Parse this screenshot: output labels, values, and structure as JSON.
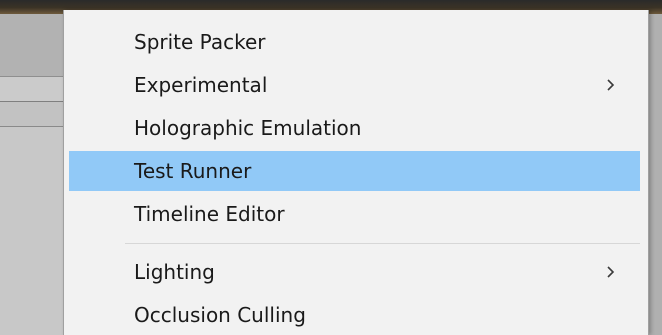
{
  "menu": {
    "items": [
      {
        "label": "Sprite Packer",
        "has_submenu": false,
        "highlighted": false
      },
      {
        "label": "Experimental",
        "has_submenu": true,
        "highlighted": false
      },
      {
        "label": "Holographic Emulation",
        "has_submenu": false,
        "highlighted": false
      },
      {
        "label": "Test Runner",
        "has_submenu": false,
        "highlighted": true
      },
      {
        "label": "Timeline Editor",
        "has_submenu": false,
        "highlighted": false
      },
      {
        "label": "Lighting",
        "has_submenu": true,
        "highlighted": false
      },
      {
        "label": "Occlusion Culling",
        "has_submenu": false,
        "highlighted": false
      }
    ],
    "submenu_icon": "chevron-right-icon"
  },
  "colors": {
    "menu_background": "#f2f2f2",
    "highlight": "#91c9f7",
    "text": "#1a1a1a",
    "separator": "#d7d7d7"
  }
}
